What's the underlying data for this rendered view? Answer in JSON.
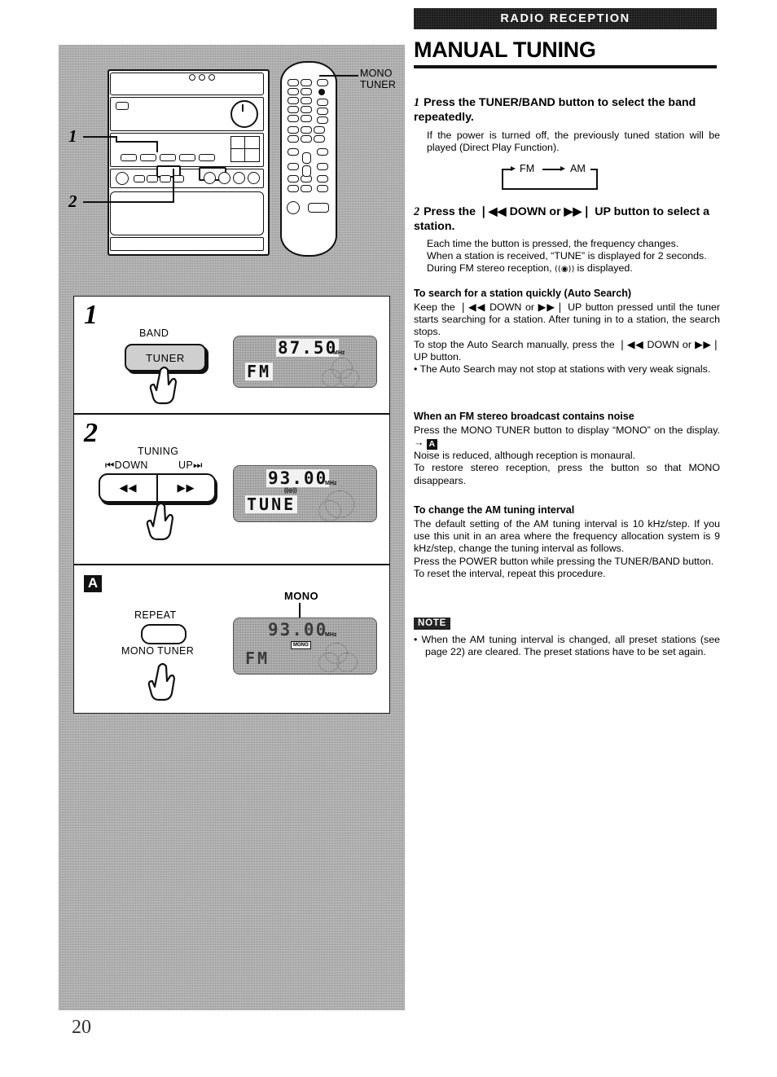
{
  "header": {
    "section_bar": "RADIO RECEPTION",
    "title": "MANUAL TUNING"
  },
  "page_number": "20",
  "illustration": {
    "callout_1": "1",
    "callout_2": "2",
    "remote_label_line1": "MONO",
    "remote_label_line2": "TUNER"
  },
  "steps": [
    {
      "num": "1",
      "label_top": "BAND",
      "button_label": "TUNER",
      "display": {
        "frequency": "87.50",
        "unit": "MHz",
        "band": "FM"
      }
    },
    {
      "num": "2",
      "label_top": "TUNING",
      "label_down": "DOWN",
      "label_up": "UP",
      "btn_left": "◀◀",
      "btn_right": "▶▶",
      "display": {
        "frequency": "93.00",
        "unit": "MHz",
        "word": "TUNE",
        "stereo_icon": "stereo-indicator"
      }
    }
  ],
  "panel_a": {
    "badge": "A",
    "label_above": "REPEAT",
    "label_below": "MONO TUNER",
    "display_callout": "MONO",
    "display": {
      "frequency": "93.00",
      "unit": "MHz",
      "mono_tag": "MONO",
      "band": "FM"
    }
  },
  "instructions": {
    "step1": {
      "number": "1",
      "heading": "Press the TUNER/BAND button to select the band repeatedly.",
      "body": "If the power is turned off, the previously tuned station will be played (Direct Play Function).",
      "band_loop": {
        "first": "FM",
        "second": "AM"
      }
    },
    "step2": {
      "number": "2",
      "heading": "Press the ❘◀◀ DOWN or ▶▶❘ UP button to select a station.",
      "line1": "Each time the button is pressed, the frequency changes.",
      "line2": "When a station is received, “TUNE” is displayed for 2 seconds.",
      "line3_pre": "During FM stereo reception, ",
      "line3_icon": "((◉)) ",
      "line3_post": "is displayed."
    },
    "auto_search": {
      "heading": "To search for a station quickly (Auto Search)",
      "body1": "Keep the ❘◀◀ DOWN or ▶▶❘ UP button pressed until the tuner starts searching for a station.  After tuning in to a station, the search stops.",
      "body2": "To stop the Auto Search manually, press the ❘◀◀ DOWN or ▶▶❘ UP button.",
      "bullet": "• The Auto Search may not stop at stations with very weak signals."
    },
    "fm_noise": {
      "heading": "When an FM stereo broadcast contains noise",
      "body1_pre": "Press the MONO TUNER button to display “MONO” on the display. → ",
      "body1_badge": "A",
      "body2": "Noise is reduced, although reception is monaural.",
      "body3": "To restore stereo reception, press the button so that MONO disappears."
    },
    "am_interval": {
      "heading": "To change the AM tuning interval",
      "body1": "The default setting of the AM tuning interval is 10 kHz/step.  If you use this unit in an area where the frequency allocation system is 9 kHz/step, change the tuning interval as follows.",
      "body2": "Press the POWER button while pressing the TUNER/BAND button.",
      "body3": "To reset the interval, repeat this procedure."
    },
    "note": {
      "badge": "NOTE",
      "body": "• When the AM tuning interval is changed, all preset stations (see page 22) are cleared.  The preset stations have to be set again."
    }
  }
}
